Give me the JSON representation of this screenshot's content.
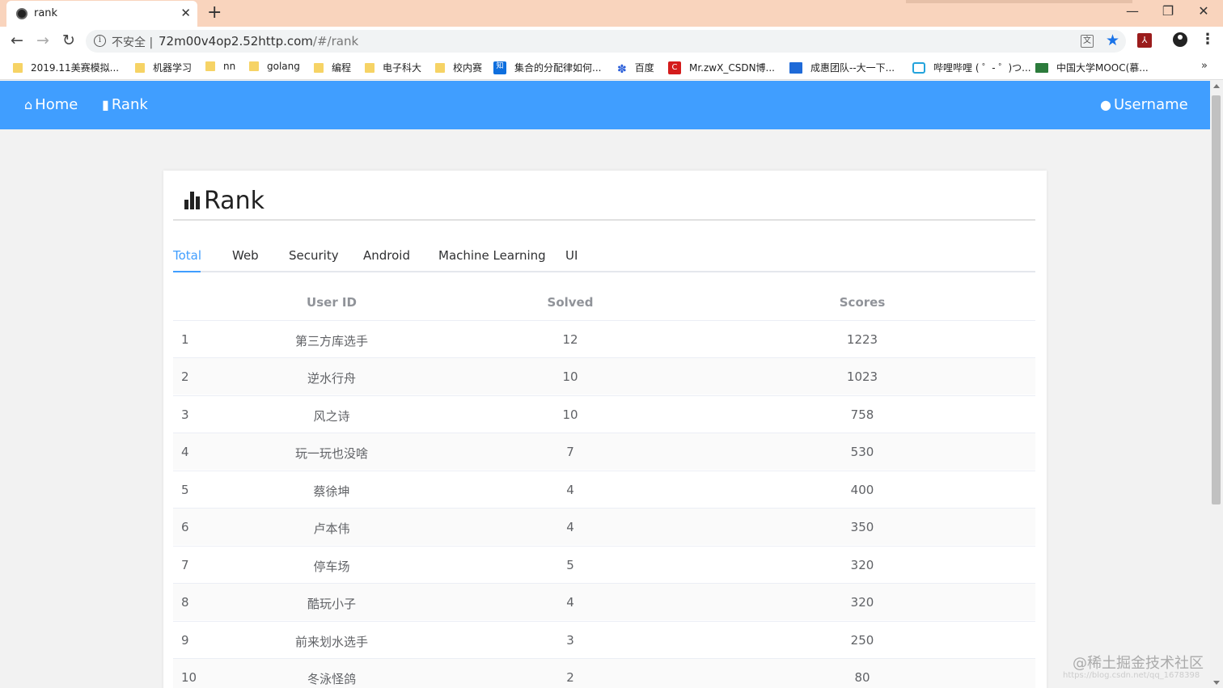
{
  "browser": {
    "tab_title": "rank",
    "omnibox_insecure": "不安全",
    "omnibox_separator": "|",
    "url_host": "72m00v4op2.52http.com",
    "url_path": "/#/rank",
    "bookmarks": [
      {
        "label": "2019.11美赛模拟...",
        "icon": "folder-icon"
      },
      {
        "label": "机器学习",
        "icon": "folder-icon"
      },
      {
        "label": "nn",
        "icon": "folder-icon"
      },
      {
        "label": "golang",
        "icon": "folder-icon"
      },
      {
        "label": "编程",
        "icon": "folder-icon"
      },
      {
        "label": "电子科大",
        "icon": "folder-icon"
      },
      {
        "label": "校内赛",
        "icon": "folder-icon"
      },
      {
        "label": "集合的分配律如何...",
        "icon": "zhihu-icon"
      },
      {
        "label": "百度",
        "icon": "baidu-paw-icon"
      },
      {
        "label": "Mr.zwX_CSDN博...",
        "icon": "csdn-icon"
      },
      {
        "label": "成惠团队--大一下...",
        "icon": "doc-icon"
      },
      {
        "label": "哔哩哔哩 ( ゜- ゜)つ...",
        "icon": "bilibili-icon"
      },
      {
        "label": "中国大学MOOC(慕...",
        "icon": "mooc-icon"
      }
    ]
  },
  "navbar": {
    "home_label": "Home",
    "rank_label": "Rank",
    "user_label": "Username",
    "color": "#409eff"
  },
  "card": {
    "title": "Rank"
  },
  "tabs": [
    "Total",
    "Web",
    "Security",
    "Android",
    "Machine Learning",
    "UI"
  ],
  "active_tab": "Total",
  "table": {
    "headers": [
      "User ID",
      "Solved",
      "Scores"
    ],
    "rows": [
      [
        "1",
        "第三方库选手",
        "12",
        "1223"
      ],
      [
        "2",
        "逆水行舟",
        "10",
        "1023"
      ],
      [
        "3",
        "风之诗",
        "10",
        "758"
      ],
      [
        "4",
        "玩一玩也没啥",
        "7",
        "530"
      ],
      [
        "5",
        "蔡徐坤",
        "4",
        "400"
      ],
      [
        "6",
        "卢本伟",
        "4",
        "350"
      ],
      [
        "7",
        "停车场",
        "5",
        "320"
      ],
      [
        "8",
        "酷玩小子",
        "4",
        "320"
      ],
      [
        "9",
        "前来划水选手",
        "3",
        "250"
      ],
      [
        "10",
        "冬泳怪鸽",
        "2",
        "80"
      ]
    ]
  },
  "watermark": "@稀土掘金技术社区",
  "watermark_url": "https://blog.csdn.net/qq_1678398"
}
